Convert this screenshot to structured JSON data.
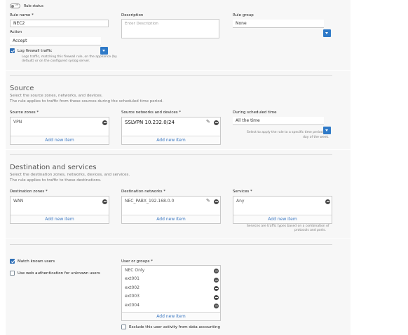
{
  "rule_status": {
    "label": "Rule status",
    "toggle_text": "Off"
  },
  "rule_name": {
    "label": "Rule name",
    "value": "NEC2"
  },
  "description": {
    "label": "Description",
    "placeholder": "Enter Description"
  },
  "rule_group": {
    "label": "Rule group",
    "value": "None"
  },
  "action": {
    "label": "Action",
    "value": "Accept"
  },
  "log": {
    "label": "Log firewall traffic",
    "checked": true,
    "help_lines": [
      "Logs traffic, matching this firewall rule, on the appliance (by",
      "default) or on the configured syslog server."
    ]
  },
  "source": {
    "title": "Source",
    "desc_lines": [
      "Select the source zones, networks, and devices.",
      "The rule applies to traffic from these sources during the scheduled time period."
    ],
    "zones": {
      "label": "Source zones",
      "items": [
        "VPN"
      ],
      "add": "Add new item"
    },
    "networks": {
      "label": "Source networks and devices",
      "items": [
        "SSLVPN 10.232.0/24"
      ],
      "add": "Add new item"
    },
    "schedule": {
      "label": "During scheduled time",
      "value": "All the time",
      "help_lines": [
        "Select to apply the rule to a specific time period,",
        "day of the week."
      ]
    }
  },
  "destination": {
    "title": "Destination and services",
    "desc_lines": [
      "Select the destination zones, networks, devices, and services.",
      "The rule applies to traffic to these destinations."
    ],
    "zones": {
      "label": "Destination zones",
      "items": [
        "WAN"
      ],
      "add": "Add new item"
    },
    "networks": {
      "label": "Destination networks",
      "items": [
        "NEC_PABX_192.168.0.0"
      ],
      "add": "Add new item"
    },
    "services": {
      "label": "Services",
      "items": [
        "Any"
      ],
      "add": "Add new item",
      "help_lines": [
        "Services are traffic types based on a combination of",
        "protocols and ports."
      ]
    }
  },
  "identity": {
    "match_known": {
      "label": "Match known users",
      "checked": true
    },
    "web_auth": {
      "label": "Use web authentication for unknown users",
      "checked": false
    },
    "users": {
      "label": "User or groups",
      "items": [
        "NEC Only",
        "ext001",
        "ext002",
        "ext003",
        "ext004"
      ],
      "add": "Add new item"
    },
    "exclude": {
      "label": "Exclude this user activity from data accounting",
      "checked": false
    }
  },
  "required_mark": "*"
}
